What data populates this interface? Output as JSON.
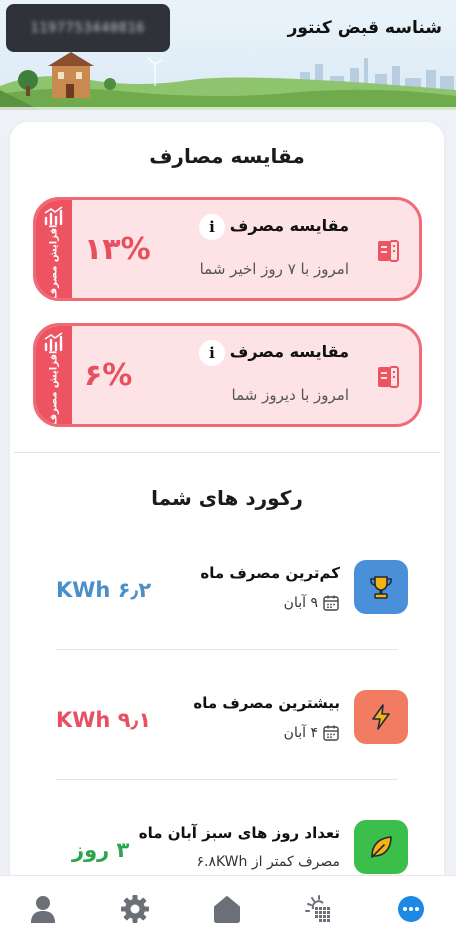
{
  "header": {
    "title": "شناسه قبض کنتور",
    "bill_id_masked": "1197753440816"
  },
  "comparison": {
    "title": "مقایسه مصارف",
    "cards": [
      {
        "percent": "۱۳%",
        "label": "مقایسه مصرف",
        "info_label": "i",
        "subtitle": "امروز با ۷ روز اخیر شما",
        "badge": "افزایش مصرف",
        "icon": "electric-meter-icon"
      },
      {
        "percent": "۶%",
        "label": "مقایسه مصرف",
        "info_label": "i",
        "subtitle": "امروز با دیروز شما",
        "badge": "افزایش مصرف",
        "icon": "electric-meter-icon"
      }
    ]
  },
  "records": {
    "title": "رکورد های شما",
    "items": [
      {
        "title": "کم‌ترین مصرف ماه",
        "subtitle": "۹ آبان",
        "value": "۶٫۲ KWh",
        "icon": "trophy-icon",
        "color": "#4a90d9",
        "value_color": "#4a8fc9"
      },
      {
        "title": "بیشترین مصرف ماه",
        "subtitle": "۴ آبان",
        "value": "۹٫۱ KWh",
        "icon": "lightning-icon",
        "color": "#f27c62",
        "value_color": "#e8505f"
      },
      {
        "title": "تعداد روز های سبز آبان ماه",
        "subtitle": "مصرف کمتر از ۶.۸KWh",
        "value": "۳ روز",
        "icon": "leaf-icon",
        "color": "#3bbf4a",
        "value_color": "#2aa64a"
      }
    ]
  },
  "nav": {
    "items": [
      "profile-icon",
      "settings-icon",
      "home-icon",
      "solar-icon",
      "more-icon"
    ],
    "active_color": "#1e88e5"
  }
}
